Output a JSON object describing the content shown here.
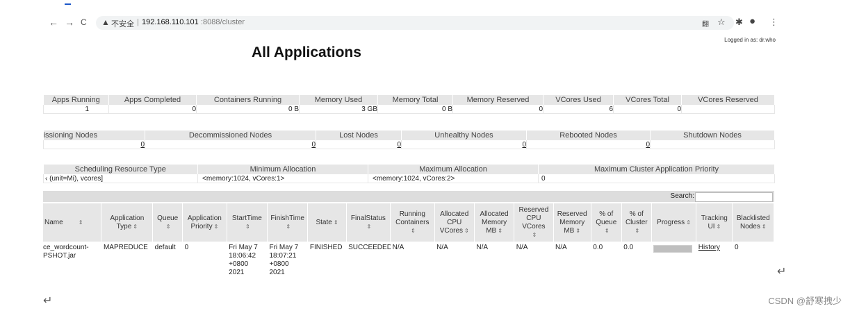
{
  "browser": {
    "back_icon": "←",
    "forward_icon": "→",
    "reload_icon": "C",
    "warning_icon": "▲",
    "insecure_label": "不安全",
    "separator": "|",
    "host": "192.168.110.101",
    "path": ":8088/cluster",
    "translate_icon": "翻",
    "star_icon": "☆",
    "extension_icon": "✱",
    "profile_icon": "●",
    "menu_icon": "⋮"
  },
  "header": {
    "logged_in": "Logged in as: dr.who",
    "title": "All Applications"
  },
  "cluster_metrics": {
    "headers": [
      "Apps Running",
      "Apps Completed",
      "Containers Running",
      "Memory Used",
      "Memory Total",
      "Memory Reserved",
      "VCores Used",
      "VCores Total",
      "VCores Reserved"
    ],
    "values": [
      "1",
      "0",
      "0 B",
      "3 GB",
      "0 B",
      "0",
      "6",
      "0",
      ""
    ]
  },
  "node_metrics": {
    "headers": [
      "issioning Nodes",
      "Decommissioned Nodes",
      "Lost Nodes",
      "Unhealthy Nodes",
      "Rebooted Nodes",
      "Shutdown Nodes"
    ],
    "values": [
      "0",
      "0",
      "0",
      "0",
      "0",
      ""
    ]
  },
  "scheduler_metrics": {
    "headers": [
      "Scheduling Resource Type",
      "Minimum Allocation",
      "Maximum Allocation",
      "Maximum Cluster Application Priority"
    ],
    "values": [
      "‹ (unit=Mi), vcores]",
      "<memory:1024, vCores:1>",
      "<memory:1024, vCores:2>",
      "0"
    ]
  },
  "search": {
    "label": "Search:",
    "value": ""
  },
  "apps_table": {
    "headers": [
      "Name",
      "Application Type",
      "Queue",
      "Application Priority",
      "StartTime",
      "FinishTime",
      "State",
      "FinalStatus",
      "Running Containers",
      "Allocated CPU VCores",
      "Allocated Memory MB",
      "Reserved CPU VCores",
      "Reserved Memory MB",
      "% of Queue",
      "% of Cluster",
      "Progress",
      "Tracking UI",
      "Blacklisted Nodes"
    ],
    "sort_icon": "⇕",
    "rows": [
      {
        "name_line1": "ce_wordcount-",
        "name_line2": "PSHOT.jar",
        "type": "MAPREDUCE",
        "queue": "default",
        "priority": "0",
        "start": "Fri May 7 18:06:42 +0800 2021",
        "finish": "Fri May 7 18:07:21 +0800 2021",
        "state": "FINISHED",
        "final_status": "SUCCEEDED",
        "running_containers": "N/A",
        "alloc_cpu": "N/A",
        "alloc_mem": "N/A",
        "res_cpu": "N/A",
        "res_mem": "N/A",
        "pct_queue": "0.0",
        "pct_cluster": "0.0",
        "progress_pct": 100,
        "tracking": "History",
        "blacklisted": "0"
      }
    ]
  },
  "return_symbol": "↵",
  "watermark": "CSDN @舒寒拽少"
}
